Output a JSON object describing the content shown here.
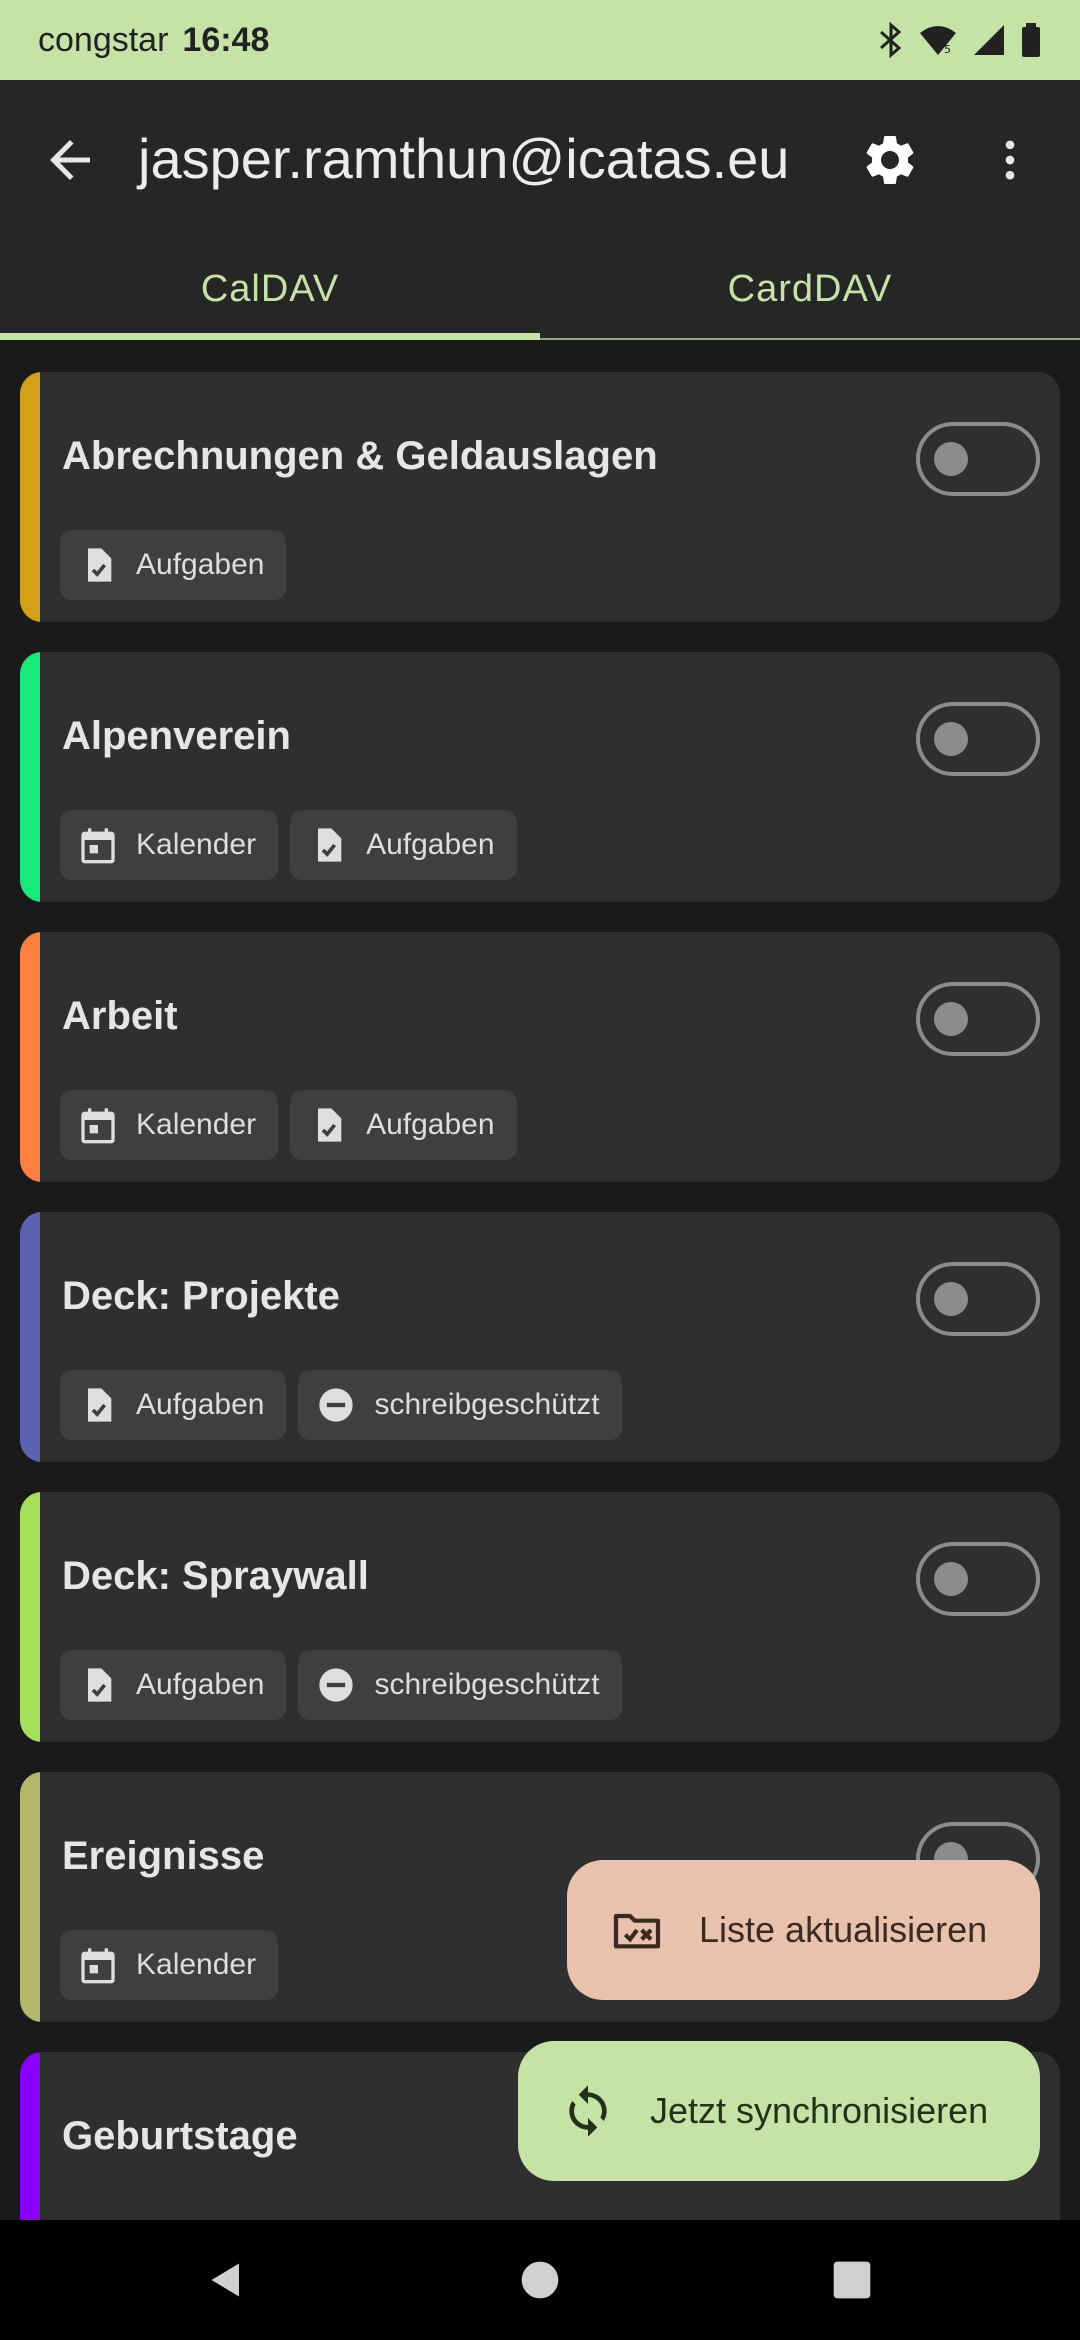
{
  "status_bar": {
    "carrier": "congstar",
    "time": "16:48"
  },
  "app_bar": {
    "title": "jasper.ramthun@icatas.eu"
  },
  "tabs": [
    {
      "label": "CalDAV",
      "active": true
    },
    {
      "label": "CardDAV",
      "active": false
    }
  ],
  "collections": [
    {
      "name": "Abrechnungen & Geldauslagen",
      "color": "#d4a017",
      "enabled": false,
      "chips": [
        {
          "icon": "task-icon",
          "label": "Aufgaben"
        }
      ]
    },
    {
      "name": "Alpenverein",
      "color": "#19e97a",
      "enabled": false,
      "chips": [
        {
          "icon": "calendar-icon",
          "label": "Kalender"
        },
        {
          "icon": "task-icon",
          "label": "Aufgaben"
        }
      ]
    },
    {
      "name": "Arbeit",
      "color": "#ff7f3f",
      "enabled": false,
      "chips": [
        {
          "icon": "calendar-icon",
          "label": "Kalender"
        },
        {
          "icon": "task-icon",
          "label": "Aufgaben"
        }
      ]
    },
    {
      "name": "Deck: Projekte",
      "color": "#5a63b0",
      "enabled": false,
      "chips": [
        {
          "icon": "task-icon",
          "label": "Aufgaben"
        },
        {
          "icon": "read-only-icon",
          "label": "schreibgeschützt"
        }
      ]
    },
    {
      "name": "Deck: Spraywall",
      "color": "#a6e05a",
      "enabled": false,
      "chips": [
        {
          "icon": "task-icon",
          "label": "Aufgaben"
        },
        {
          "icon": "read-only-icon",
          "label": "schreibgeschützt"
        }
      ]
    },
    {
      "name": "Ereignisse",
      "color": "#b5b86a",
      "enabled": false,
      "chips": [
        {
          "icon": "calendar-icon",
          "label": "Kalender"
        }
      ]
    },
    {
      "name": "Geburtstage",
      "color": "#8a00ff",
      "enabled": false,
      "chips": []
    }
  ],
  "fabs": {
    "refresh_label": "Liste aktualisieren",
    "sync_label": "Jetzt synchronisieren"
  },
  "colors": {
    "accent": "#c5e3a7",
    "refresh_fab": "#e8c2ad"
  }
}
